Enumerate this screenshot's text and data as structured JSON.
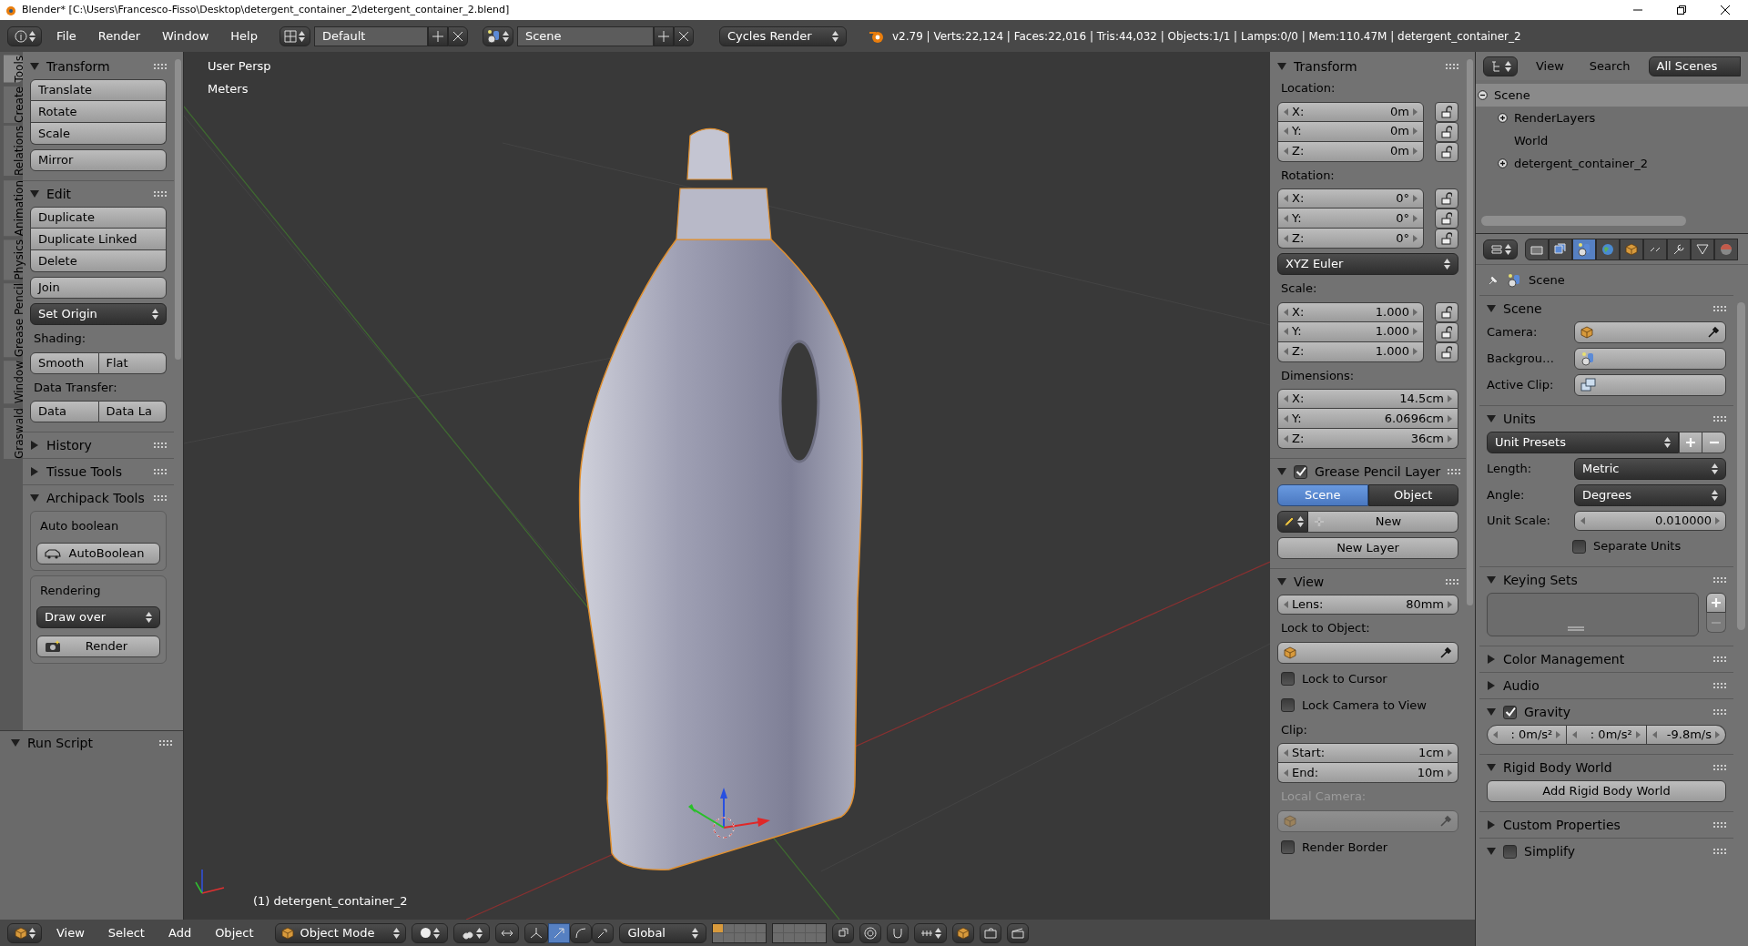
{
  "window": {
    "title": "Blender* [C:\\Users\\Francesco-Fisso\\Desktop\\detergent_container_2\\detergent_container_2.blend]"
  },
  "top_header": {
    "menus": [
      "File",
      "Render",
      "Window",
      "Help"
    ],
    "layout": "Default",
    "scene": "Scene",
    "engine": "Cycles Render",
    "stats": "v2.79 | Verts:22,124 | Faces:22,016 | Tris:44,032 | Objects:1/1 | Lamps:0/0 | Mem:110.47M | detergent_container_2"
  },
  "tool_tabs": [
    {
      "label": "Tools",
      "selected": true
    },
    {
      "label": "Create",
      "selected": false
    },
    {
      "label": "Relations",
      "selected": false
    },
    {
      "label": "Animation",
      "selected": false
    },
    {
      "label": "Physics",
      "selected": false
    },
    {
      "label": "Grease Pencil",
      "selected": false
    },
    {
      "label": "Window",
      "selected": false
    },
    {
      "label": "Graswald",
      "selected": false
    }
  ],
  "tool_shelf": {
    "sections": [
      {
        "title": "Transform",
        "expanded": true,
        "items": [
          {
            "kind": "buttons",
            "labels": [
              "Translate",
              "Rotate",
              "Scale"
            ]
          },
          {
            "kind": "buttons",
            "labels": [
              "Mirror"
            ]
          }
        ]
      },
      {
        "title": "Edit",
        "expanded": true,
        "items": [
          {
            "kind": "buttons",
            "labels": [
              "Duplicate",
              "Duplicate Linked",
              "Delete"
            ]
          },
          {
            "kind": "buttons",
            "labels": [
              "Join"
            ]
          },
          {
            "kind": "dropdown",
            "text": "Set Origin"
          },
          {
            "kind": "label",
            "text": "Shading:"
          },
          {
            "kind": "row",
            "labels": [
              "Smooth",
              "Flat"
            ]
          },
          {
            "kind": "label",
            "text": "Data Transfer:"
          },
          {
            "kind": "row",
            "labels": [
              "Data",
              "Data La"
            ]
          }
        ]
      },
      {
        "title": "History",
        "expanded": false
      },
      {
        "title": "Tissue Tools",
        "expanded": false
      },
      {
        "title": "Archipack Tools",
        "expanded": true,
        "items": [
          {
            "kind": "box",
            "items": [
              {
                "kind": "label",
                "text": "Auto boolean"
              },
              {
                "kind": "icon_button",
                "text": "AutoBoolean"
              }
            ]
          },
          {
            "kind": "box",
            "items": [
              {
                "kind": "label",
                "text": "Rendering"
              },
              {
                "kind": "dropdown",
                "text": "Draw over"
              },
              {
                "kind": "icon_button",
                "text": "Render"
              }
            ]
          }
        ]
      }
    ]
  },
  "operator_panel": {
    "title": "Run Script",
    "expanded": true
  },
  "viewport": {
    "view_name": "User Persp",
    "units": "Meters",
    "object_info": "(1) detergent_container_2"
  },
  "n_panel": {
    "sections": [
      {
        "title": "Transform",
        "expanded": true,
        "items": [
          {
            "kind": "label",
            "text": "Location:"
          },
          {
            "kind": "vector",
            "fields": [
              {
                "axis": "X:",
                "value": "0m",
                "locked": false
              },
              {
                "axis": "Y:",
                "value": "0m",
                "locked": false
              },
              {
                "axis": "Z:",
                "value": "0m",
                "locked": false
              }
            ]
          },
          {
            "kind": "label",
            "text": "Rotation:"
          },
          {
            "kind": "vector",
            "fields": [
              {
                "axis": "X:",
                "value": "0°",
                "locked": false
              },
              {
                "axis": "Y:",
                "value": "0°",
                "locked": false
              },
              {
                "axis": "Z:",
                "value": "0°",
                "locked": false
              }
            ]
          },
          {
            "kind": "dropdown",
            "text": "XYZ Euler"
          },
          {
            "kind": "label",
            "text": "Scale:"
          },
          {
            "kind": "vector",
            "fields": [
              {
                "axis": "X:",
                "value": "1.000",
                "locked": false
              },
              {
                "axis": "Y:",
                "value": "1.000",
                "locked": false
              },
              {
                "axis": "Z:",
                "value": "1.000",
                "locked": false
              }
            ]
          },
          {
            "kind": "label",
            "text": "Dimensions:"
          },
          {
            "kind": "vector",
            "fields": [
              {
                "axis": "X:",
                "value": "14.5cm"
              },
              {
                "axis": "Y:",
                "value": "6.0696cm"
              },
              {
                "axis": "Z:",
                "value": "36cm"
              }
            ]
          }
        ]
      },
      {
        "title": "Grease Pencil Layer",
        "expanded": true,
        "checked": true,
        "items": [
          {
            "kind": "tabs",
            "options": [
              {
                "label": "Scene",
                "selected": true
              },
              {
                "label": "Object",
                "selected": false
              }
            ]
          },
          {
            "kind": "new_row",
            "text": "New"
          },
          {
            "kind": "button",
            "text": "New Layer"
          }
        ]
      },
      {
        "title": "View",
        "expanded": true,
        "items": [
          {
            "kind": "field",
            "label": "Lens:",
            "value": "80mm"
          },
          {
            "kind": "label",
            "text": "Lock to Object:",
            "disabled": false
          },
          {
            "kind": "object_field",
            "disabled": false
          },
          {
            "kind": "checkbox",
            "label": "Lock to Cursor",
            "checked": false
          },
          {
            "kind": "checkbox",
            "label": "Lock Camera to View",
            "checked": false
          },
          {
            "kind": "label",
            "text": "Clip:",
            "disabled": false
          },
          {
            "kind": "vector",
            "fields": [
              {
                "axis": "Start:",
                "value": "1cm"
              },
              {
                "axis": "End:",
                "value": "10m"
              }
            ]
          },
          {
            "kind": "label",
            "text": "Local Camera:",
            "disabled": true
          },
          {
            "kind": "object_field",
            "disabled": true
          },
          {
            "kind": "checkbox",
            "label": "Render Border",
            "checked": false
          }
        ]
      }
    ]
  },
  "viewport_header": {
    "menus": [
      "View",
      "Select",
      "Add",
      "Object"
    ],
    "mode": "Object Mode",
    "orientation": "Global"
  },
  "outliner": {
    "menus": [
      "View",
      "Search"
    ],
    "filter": "All Scenes",
    "tree": [
      {
        "label": "Scene",
        "expanded": true,
        "selected": true,
        "children": [
          {
            "label": "RenderLayers",
            "expanded": false,
            "selected": false
          },
          {
            "label": "World",
            "selected": false
          },
          {
            "label": "detergent_container_2",
            "expanded": false,
            "selected": false
          }
        ]
      }
    ]
  },
  "properties": {
    "tabs": [
      {
        "selected": false
      },
      {
        "selected": false
      },
      {
        "selected": true
      },
      {
        "selected": false
      },
      {
        "selected": false
      },
      {
        "selected": false
      },
      {
        "selected": false
      },
      {
        "selected": false
      },
      {
        "selected": false
      }
    ],
    "context": "Scene",
    "sections": [
      {
        "title": "Scene",
        "expanded": true,
        "items": [
          {
            "kind": "prop",
            "label": "Camera:",
            "control": {
              "kind": "id_field"
            }
          },
          {
            "kind": "prop",
            "label": "Backgrou…",
            "control": {
              "kind": "id_field"
            }
          },
          {
            "kind": "prop",
            "label": "Active Clip:",
            "control": {
              "kind": "id_field"
            }
          }
        ]
      },
      {
        "title": "Units",
        "expanded": true,
        "items": [
          {
            "kind": "preset",
            "text": "Unit Presets"
          },
          {
            "kind": "prop",
            "label": "Length:",
            "control": {
              "kind": "dropdown",
              "text": "Metric"
            }
          },
          {
            "kind": "prop",
            "label": "Angle:",
            "control": {
              "kind": "dropdown",
              "text": "Degrees"
            }
          },
          {
            "kind": "prop",
            "label": "Unit Scale:",
            "control": {
              "kind": "field",
              "value": "0.010000"
            }
          },
          {
            "kind": "prop_checkbox",
            "label": "Separate Units",
            "checked": false
          }
        ]
      },
      {
        "title": "Keying Sets",
        "expanded": true,
        "items": [
          {
            "kind": "list"
          }
        ]
      },
      {
        "title": "Color Management",
        "expanded": false
      },
      {
        "title": "Audio",
        "expanded": false
      },
      {
        "title": "Gravity",
        "expanded": true,
        "checked": true,
        "items": [
          {
            "kind": "triple",
            "values": [
              ": 0m/s²",
              ": 0m/s²",
              "-9.8m/s"
            ]
          }
        ]
      },
      {
        "title": "Rigid Body World",
        "expanded": true,
        "items": [
          {
            "kind": "button",
            "text": "Add Rigid Body World"
          }
        ]
      },
      {
        "title": "Custom Properties",
        "expanded": false
      },
      {
        "title": "Simplify",
        "expanded": true,
        "checked": false
      }
    ]
  }
}
